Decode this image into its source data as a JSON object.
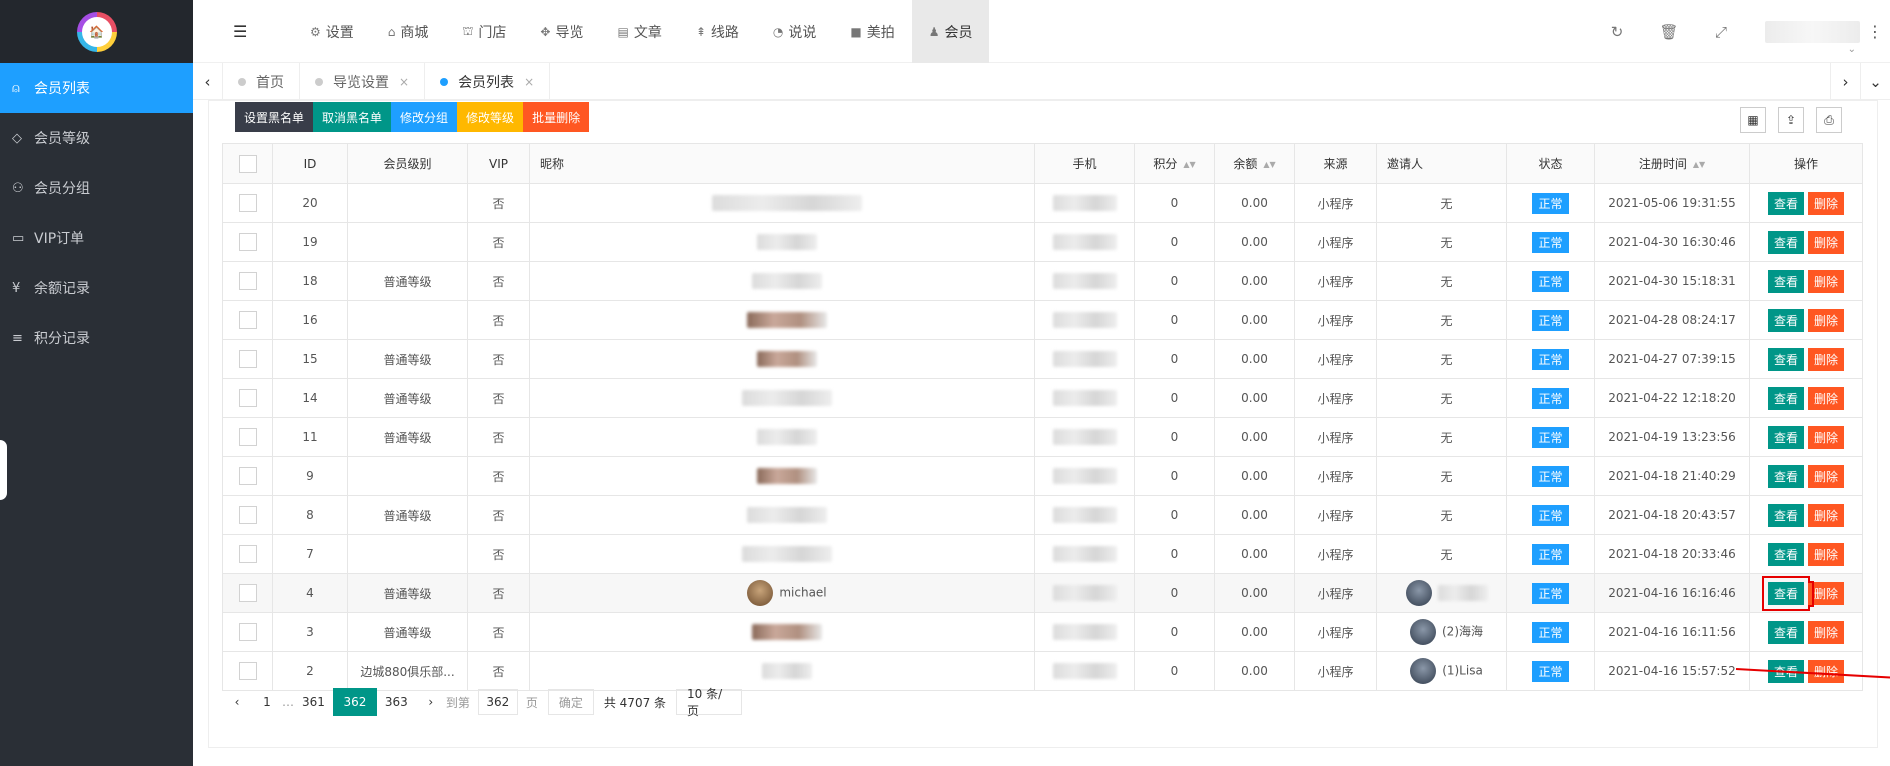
{
  "logo": {
    "text": "🏠"
  },
  "sidebar": {
    "items": [
      {
        "icon": "user-icon",
        "glyph": "⍝",
        "label": "会员列表",
        "active": true
      },
      {
        "icon": "diamond-icon",
        "glyph": "◇",
        "label": "会员等级"
      },
      {
        "icon": "users-icon",
        "glyph": "⚇",
        "label": "会员分组"
      },
      {
        "icon": "vip-icon",
        "glyph": "▭",
        "label": "VIP订单"
      },
      {
        "icon": "yen-icon",
        "glyph": "¥",
        "label": "余额记录"
      },
      {
        "icon": "database-icon",
        "glyph": "≡",
        "label": "积分记录"
      }
    ]
  },
  "topnav": {
    "fold_glyph": "☰",
    "items": [
      {
        "icon": "gears-icon",
        "glyph": "⚙",
        "label": "设置"
      },
      {
        "icon": "shop-icon",
        "glyph": "⌂",
        "label": "商城"
      },
      {
        "icon": "bank-icon",
        "glyph": "⛫",
        "label": "门店"
      },
      {
        "icon": "map-icon",
        "glyph": "✥",
        "label": "导览"
      },
      {
        "icon": "article-icon",
        "glyph": "▤",
        "label": "文章"
      },
      {
        "icon": "route-icon",
        "glyph": "⇞",
        "label": "线路"
      },
      {
        "icon": "wechat-icon",
        "glyph": "◔",
        "label": "说说"
      },
      {
        "icon": "video-icon",
        "glyph": "■",
        "label": "美拍"
      },
      {
        "icon": "member-icon",
        "glyph": "♟",
        "label": "会员",
        "active": true
      }
    ],
    "right": {
      "refresh": "↻",
      "trash": "🗑",
      "fullscreen": "⤢",
      "caret": "⌄",
      "more": "⋮"
    }
  },
  "tabs": [
    {
      "label": "首页"
    },
    {
      "label": "导览设置"
    },
    {
      "label": "会员列表",
      "active": true
    }
  ],
  "tab_arrows": {
    "left": "‹",
    "right": "›",
    "down": "⌄",
    "close": "×"
  },
  "toolbar": {
    "set_blacklist": "设置黑名单",
    "cancel_blacklist": "取消黑名单",
    "change_group": "修改分组",
    "change_level": "修改等级",
    "batch_delete": "批量删除",
    "icons": {
      "columns": "▦",
      "export": "⇪",
      "print": "⎙"
    }
  },
  "table": {
    "headers": [
      "ID",
      "会员级别",
      "VIP",
      "昵称",
      "手机",
      "积分",
      "余额",
      "来源",
      "邀请人",
      "状态",
      "注册时间",
      "操作"
    ],
    "sort_glyph": "▲▼",
    "view_label": "查看",
    "delete_label": "删除",
    "rows": [
      {
        "id": "20",
        "level": "",
        "vip": "否",
        "nick": "",
        "points": "0",
        "balance": "0.00",
        "source": "小程序",
        "inviter": "无",
        "status": "正常",
        "time": "2021-05-06 19:31:55"
      },
      {
        "id": "19",
        "level": "",
        "vip": "否",
        "nick": "",
        "points": "0",
        "balance": "0.00",
        "source": "小程序",
        "inviter": "无",
        "status": "正常",
        "time": "2021-04-30 16:30:46"
      },
      {
        "id": "18",
        "level": "普通等级",
        "vip": "否",
        "nick": "",
        "points": "0",
        "balance": "0.00",
        "source": "小程序",
        "inviter": "无",
        "status": "正常",
        "time": "2021-04-30 15:18:31"
      },
      {
        "id": "16",
        "level": "",
        "vip": "否",
        "nick": "",
        "points": "0",
        "balance": "0.00",
        "source": "小程序",
        "inviter": "无",
        "status": "正常",
        "time": "2021-04-28 08:24:17"
      },
      {
        "id": "15",
        "level": "普通等级",
        "vip": "否",
        "nick": "",
        "points": "0",
        "balance": "0.00",
        "source": "小程序",
        "inviter": "无",
        "status": "正常",
        "time": "2021-04-27 07:39:15"
      },
      {
        "id": "14",
        "level": "普通等级",
        "vip": "否",
        "nick": "",
        "points": "0",
        "balance": "0.00",
        "source": "小程序",
        "inviter": "无",
        "status": "正常",
        "time": "2021-04-22 12:18:20"
      },
      {
        "id": "11",
        "level": "普通等级",
        "vip": "否",
        "nick": "",
        "points": "0",
        "balance": "0.00",
        "source": "小程序",
        "inviter": "无",
        "status": "正常",
        "time": "2021-04-19 13:23:56"
      },
      {
        "id": "9",
        "level": "",
        "vip": "否",
        "nick": "",
        "points": "0",
        "balance": "0.00",
        "source": "小程序",
        "inviter": "无",
        "status": "正常",
        "time": "2021-04-18 21:40:29"
      },
      {
        "id": "8",
        "level": "普通等级",
        "vip": "否",
        "nick": "",
        "points": "0",
        "balance": "0.00",
        "source": "小程序",
        "inviter": "无",
        "status": "正常",
        "time": "2021-04-18 20:43:57"
      },
      {
        "id": "7",
        "level": "",
        "vip": "否",
        "nick": "",
        "points": "0",
        "balance": "0.00",
        "source": "小程序",
        "inviter": "无",
        "status": "正常",
        "time": "2021-04-18 20:33:46"
      },
      {
        "id": "4",
        "level": "普通等级",
        "vip": "否",
        "nick": "michael",
        "points": "0",
        "balance": "0.00",
        "source": "小程序",
        "inviter": "",
        "status": "正常",
        "time": "2021-04-16 16:16:46",
        "highlight": true
      },
      {
        "id": "3",
        "level": "普通等级",
        "vip": "否",
        "nick": "",
        "points": "0",
        "balance": "0.00",
        "source": "小程序",
        "inviter": "(2)海海",
        "status": "正常",
        "time": "2021-04-16 16:11:56"
      },
      {
        "id": "2",
        "level": "边城880俱乐部...",
        "vip": "否",
        "nick": "",
        "points": "0",
        "balance": "0.00",
        "source": "小程序",
        "inviter": "(1)Lisa",
        "status": "正常",
        "time": "2021-04-16 15:57:52"
      }
    ]
  },
  "pagination": {
    "prev": "‹",
    "next": "›",
    "first": "1",
    "ellipsis": "…",
    "pages": [
      "361",
      "362",
      "363"
    ],
    "current": "362",
    "goto_label": "到第",
    "goto_value": "362",
    "page_unit": "页",
    "confirm": "确定",
    "total": "共 4707 条",
    "page_size": "10 条/页"
  },
  "colors": {
    "sidebar_bg": "#2a2f36",
    "active_blue": "#1e9fff",
    "green": "#009688",
    "orange": "#ffb800",
    "red": "#ff5722",
    "annotation_red": "#e60000"
  }
}
